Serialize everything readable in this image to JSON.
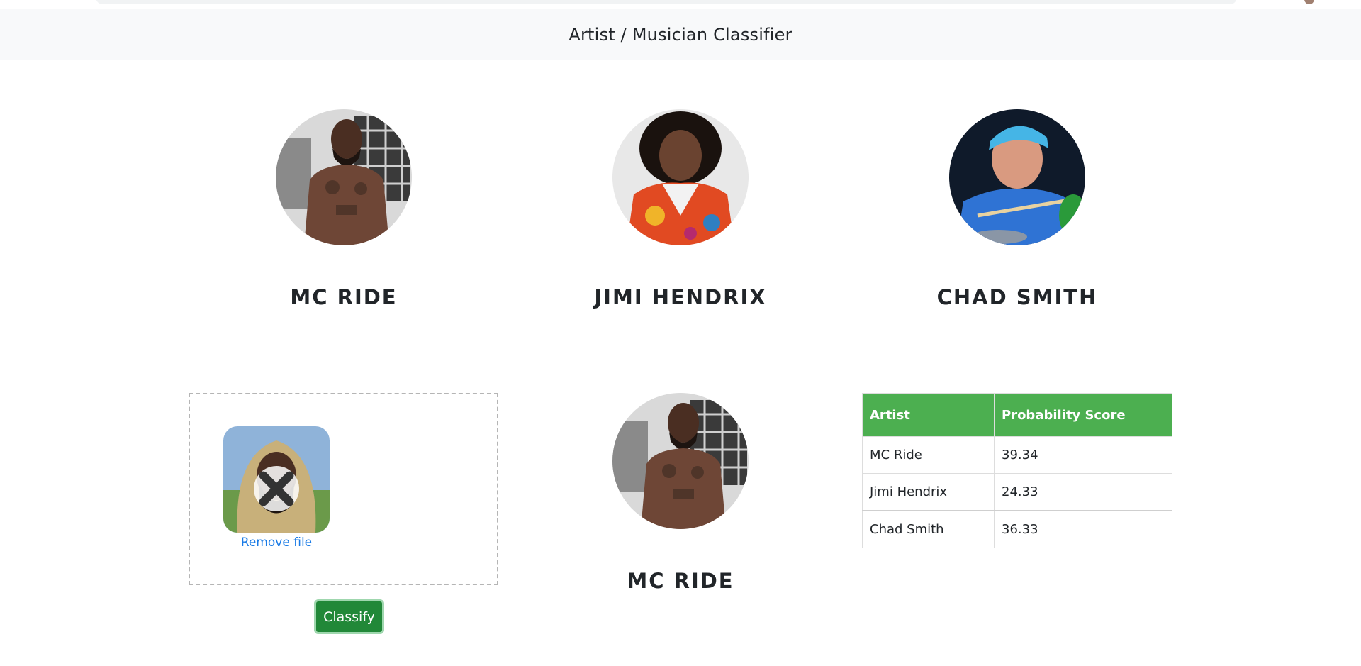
{
  "app": {
    "title": "Artist / Musician Classifier"
  },
  "colors": {
    "accent": "#4caf50",
    "button": "#218838",
    "link": "#1a7be6",
    "navbar_bg": "#f8f9fa"
  },
  "artists": [
    {
      "name": "MC RIDE",
      "photo": "mc-ride-photo"
    },
    {
      "name": "JIMI HENDRIX",
      "photo": "jimi-hendrix-photo"
    },
    {
      "name": "CHAD SMITH",
      "photo": "chad-smith-photo"
    }
  ],
  "upload": {
    "remove_label": "Remove file",
    "remove_icon": "close-icon"
  },
  "classify_button": {
    "label": "Classify"
  },
  "result": {
    "name": "MC RIDE"
  },
  "table": {
    "headers": [
      "Artist",
      "Probability Score"
    ],
    "rows": [
      {
        "artist": "MC Ride",
        "score": "39.34"
      },
      {
        "artist": "Jimi Hendrix",
        "score": "24.33"
      },
      {
        "artist": "Chad Smith",
        "score": "36.33"
      }
    ]
  }
}
